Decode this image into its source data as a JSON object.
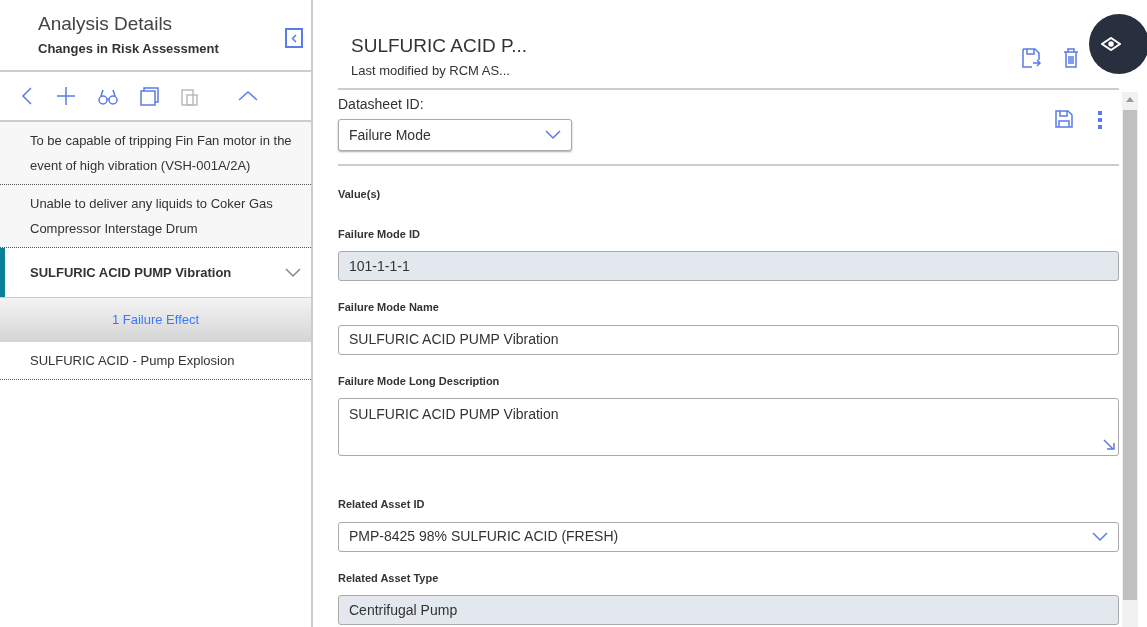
{
  "sidebar": {
    "title": "Analysis Details",
    "subtitle": "Changes in Risk Assessment",
    "items": [
      {
        "label": "To be capable of tripping Fin Fan motor in the event of high vibration (VSH-001A/2A)",
        "selected": false
      },
      {
        "label": "Unable to deliver any liquids to Coker Gas Compressor Interstage Drum",
        "selected": false
      },
      {
        "label": "SULFURIC ACID PUMP Vibration",
        "selected": true,
        "expanded": true,
        "child": "1 Failure Effect"
      },
      {
        "label": "SULFURIC ACID - Pump Explosion",
        "selected": false
      }
    ]
  },
  "header": {
    "title": "SULFURIC ACID P...",
    "subtitle": "Last modified by RCM AS..."
  },
  "datasheet": {
    "label": "Datasheet ID:",
    "value": "Failure Mode"
  },
  "section_label": "Value(s)",
  "fields": [
    {
      "kind": "readonly",
      "label": "Failure Mode ID",
      "value": "101-1-1-1"
    },
    {
      "kind": "text",
      "label": "Failure Mode Name",
      "value": "SULFURIC ACID PUMP Vibration"
    },
    {
      "kind": "textarea",
      "label": "Failure Mode Long Description",
      "value": "SULFURIC ACID PUMP Vibration"
    },
    {
      "kind": "select",
      "label": "Related Asset ID",
      "value": "PMP-8425 98% SULFURIC ACID (FRESH)"
    },
    {
      "kind": "readonly",
      "label": "Related Asset Type",
      "value": "Centrifugal Pump"
    }
  ]
}
